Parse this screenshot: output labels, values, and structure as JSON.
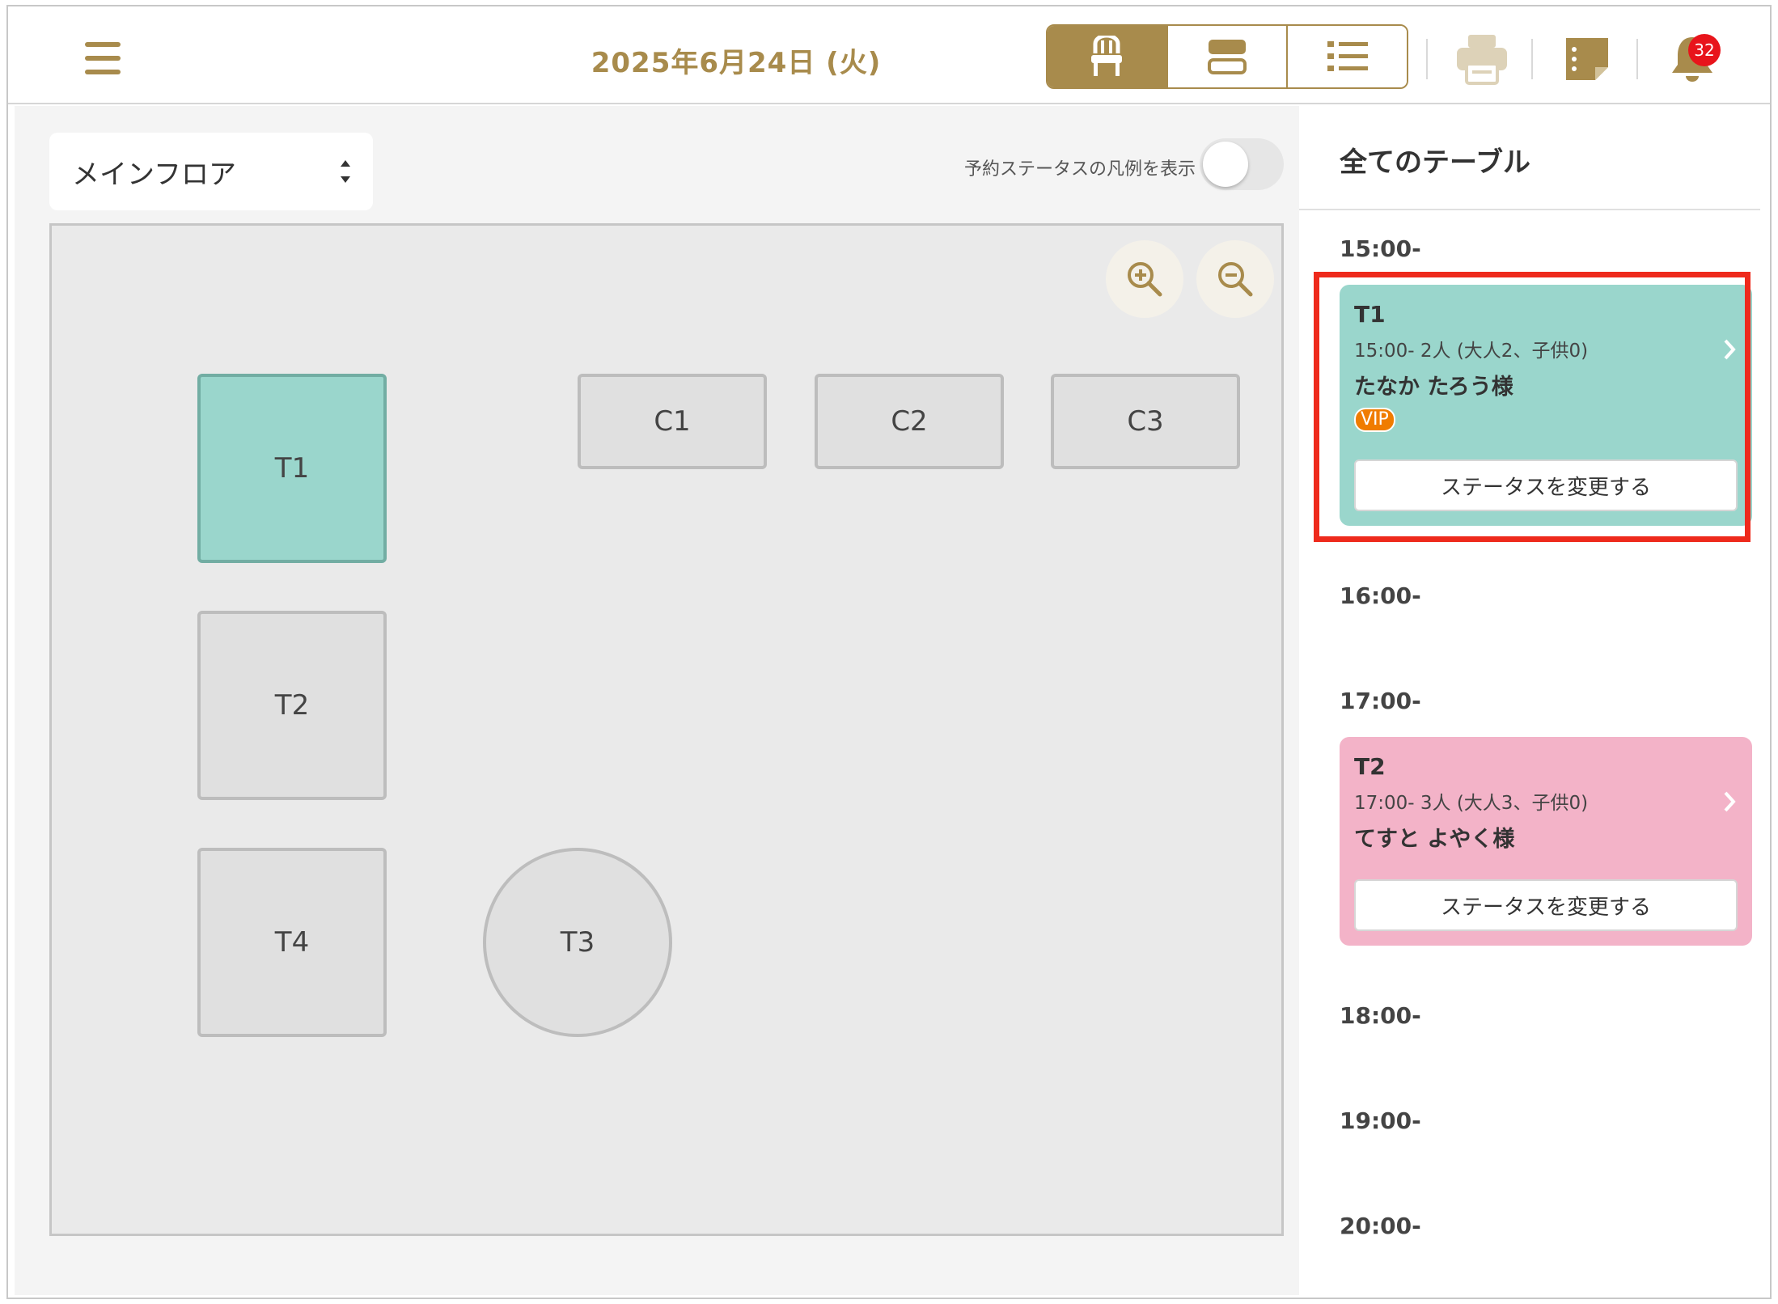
{
  "header": {
    "date": "2025年6月24日 (火)",
    "notification_count": "32"
  },
  "view_modes": [
    {
      "icon": "chair-icon",
      "active": true
    },
    {
      "icon": "timeline-icon",
      "active": false
    },
    {
      "icon": "list-icon",
      "active": false
    }
  ],
  "floor": {
    "selected_floor": "メインフロア",
    "legend_toggle_label": "予約ステータスの凡例を表示",
    "legend_toggle_on": false,
    "tables": [
      "T1",
      "C1",
      "C2",
      "C3",
      "T2",
      "T4",
      "T3"
    ]
  },
  "sidebar": {
    "title": "全てのテーブル",
    "time_slots": [
      "15:00-",
      "16:00-",
      "17:00-",
      "18:00-",
      "19:00-",
      "20:00-"
    ],
    "reservations": [
      {
        "table": "T1",
        "info": "15:00- 2人 (大人2、子供0)",
        "guest": "たなか たろう様",
        "tag": "VIP",
        "status_button": "ステータスを変更する",
        "color": "#9ad6cc"
      },
      {
        "table": "T2",
        "info": "17:00- 3人 (大人3、子供0)",
        "guest": "てすと よやく様",
        "status_button": "ステータスを変更する",
        "color": "#f3b3c8"
      }
    ]
  },
  "colors": {
    "brand": "#a88b4c",
    "occupied": "#9ad6cc",
    "reserved": "#f3b3c8",
    "highlight": "#ee2a1c"
  }
}
